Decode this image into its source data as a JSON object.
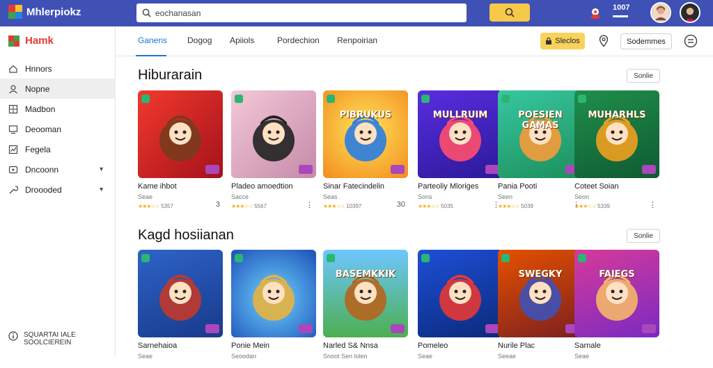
{
  "app": {
    "title": "Mhlerpiokz"
  },
  "search": {
    "value": "eochanasan"
  },
  "header": {
    "count": "1007"
  },
  "sidebar": {
    "brand": "Hamk",
    "items": [
      {
        "label": "Hnnors",
        "icon": "home-icon",
        "active": false,
        "caret": false
      },
      {
        "label": "Nopne",
        "icon": "user-icon",
        "active": true,
        "caret": false
      },
      {
        "label": "Madbon",
        "icon": "grid-icon",
        "active": false,
        "caret": false
      },
      {
        "label": "Deooman",
        "icon": "monitor-icon",
        "active": false,
        "caret": false
      },
      {
        "label": "Fegela",
        "icon": "chart-icon",
        "active": false,
        "caret": false
      },
      {
        "label": "Dncoonn",
        "icon": "card-icon",
        "active": false,
        "caret": true
      },
      {
        "label": "Droooded",
        "icon": "wrench-icon",
        "active": false,
        "caret": true
      }
    ],
    "footer": {
      "line1": "SQUARTAI IALE",
      "line2": "SOOLCIEREIN"
    }
  },
  "tabs": [
    {
      "label": "Ganens",
      "active": true
    },
    {
      "label": "Dogog",
      "active": false
    },
    {
      "label": "Apiiols",
      "active": false
    },
    {
      "label": "Pordechion",
      "active": false
    },
    {
      "label": "Renpoirian",
      "active": false
    }
  ],
  "actions": {
    "yellow_label": "Sleclos",
    "outline_label": "Sodemmes"
  },
  "sections": [
    {
      "title": "Hiburarain",
      "see_label": "Sonlie",
      "cards": [
        {
          "name": "Kame ihbot",
          "sub": "Seae",
          "rating_text": "5357",
          "extra": "3"
        },
        {
          "name": "Pladeo amoedtion",
          "sub": "Sacce",
          "rating_text": "5567",
          "extra": ""
        },
        {
          "name": "Sinar Fatecindelin",
          "sub": "Seas",
          "rating_text": "10397",
          "extra": "30"
        },
        {
          "name": "Parteoliy Mloriges",
          "sub": "Sons",
          "rating_text": "5035",
          "extra": ""
        },
        {
          "name": "Pania Pooti",
          "sub": "Seen",
          "rating_text": "5039",
          "extra": ""
        },
        {
          "name": "Coteet Soian",
          "sub": "Seon",
          "rating_text": "5339",
          "extra": ""
        }
      ]
    },
    {
      "title": "Kagd hosiianan",
      "see_label": "Sonlie",
      "cards": [
        {
          "name": "Sarnehaioa",
          "sub": "Seae",
          "rating_text": "",
          "extra": ""
        },
        {
          "name": "Ponie Mein",
          "sub": "Seoodan",
          "rating_text": "",
          "extra": ""
        },
        {
          "name": "Narled S& Nnsa",
          "sub": "Snoot Sen lolen",
          "rating_text": "",
          "extra": ""
        },
        {
          "name": "Pomeleo",
          "sub": "Seae",
          "rating_text": "",
          "extra": ""
        },
        {
          "name": "Nurile Plac",
          "sub": "Seeae",
          "rating_text": "",
          "extra": ""
        },
        {
          "name": "Sarnale",
          "sub": "Seae",
          "rating_text": "",
          "extra": ""
        }
      ]
    }
  ],
  "thumb_titles": [
    "",
    "",
    "PIBRUKUS",
    "MULLRUIM",
    "POESIEN GAMAS",
    "MUHARHLS",
    "",
    "",
    "BASEMKKIK",
    "",
    "SWEGKY",
    "FAIEGS"
  ],
  "colors": {
    "accent": "#3f51b5",
    "brand_red": "#e53935",
    "yellow": "#f9d25c",
    "link_blue": "#1976d2"
  }
}
